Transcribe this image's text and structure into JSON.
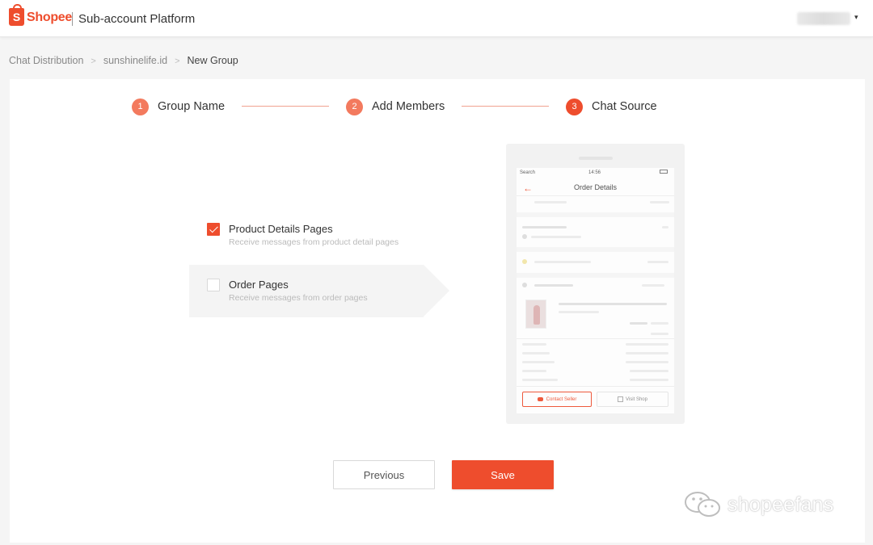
{
  "header": {
    "brand": "Shopee",
    "brand_icon_letter": "S",
    "platform_title": "Sub-account Platform",
    "user_menu_caret": "▾"
  },
  "breadcrumb": {
    "items": [
      "Chat Distribution",
      "sunshinelife.id",
      "New Group"
    ],
    "separator": ">"
  },
  "stepper": {
    "steps": [
      {
        "number": "1",
        "label": "Group Name",
        "state": "done"
      },
      {
        "number": "2",
        "label": "Add Members",
        "state": "done"
      },
      {
        "number": "3",
        "label": "Chat Source",
        "state": "active"
      }
    ]
  },
  "options": [
    {
      "title": "Product Details Pages",
      "description": "Receive messages from product detail pages",
      "checked": true,
      "highlighted": false
    },
    {
      "title": "Order Pages",
      "description": "Receive messages from order pages",
      "checked": false,
      "highlighted": true
    }
  ],
  "preview": {
    "status_left": "Search",
    "status_time": "14:56",
    "back_glyph": "←",
    "screen_title": "Order Details",
    "contact_button": "Contact Seller",
    "visit_button": "Visit Shop"
  },
  "actions": {
    "previous_label": "Previous",
    "save_label": "Save"
  },
  "watermark": {
    "text": "shopeefans"
  },
  "colors": {
    "brand": "#ee4d2d",
    "step_done": "#f37a5e",
    "step_line": "#f0a28f",
    "highlight_bg": "#f4f4f4"
  }
}
